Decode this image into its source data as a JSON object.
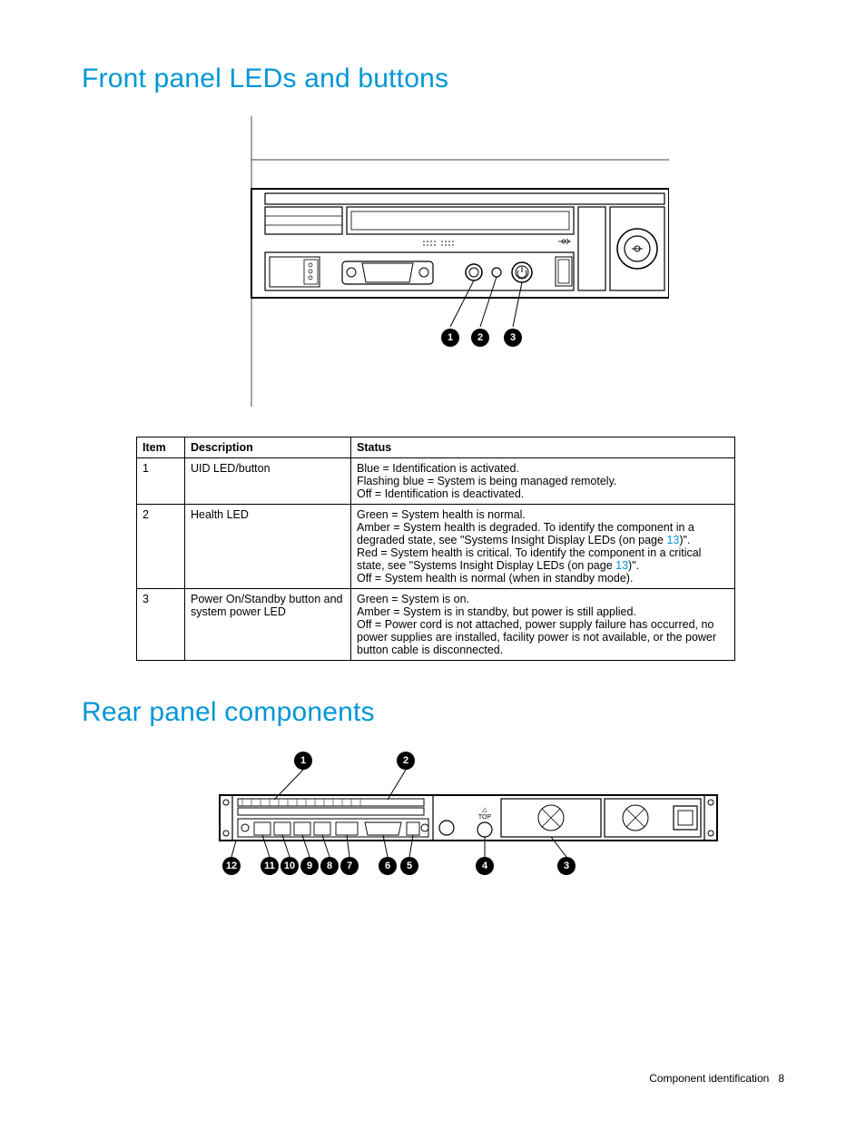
{
  "section1": {
    "heading": "Front panel LEDs and buttons",
    "callouts": [
      "1",
      "2",
      "3"
    ],
    "table": {
      "headers": [
        "Item",
        "Description",
        "Status"
      ],
      "rows": [
        {
          "item": "1",
          "description": "UID LED/button",
          "status_lines": [
            "Blue = Identification is activated.",
            "Flashing blue = System is being managed remotely.",
            "Off = Identification is deactivated."
          ]
        },
        {
          "item": "2",
          "description": "Health LED",
          "status_lines": [
            "Green = System health is normal.",
            {
              "pre": "Amber = System health is degraded. To identify the component in a degraded state, see \"Systems Insight Display LEDs (on page ",
              "link": "13",
              "post": ")\"."
            },
            {
              "pre": "Red = System health is critical. To identify the component in a critical state, see \"Systems Insight Display LEDs (on page ",
              "link": "13",
              "post": ")\"."
            },
            "Off = System health is normal (when in standby mode)."
          ]
        },
        {
          "item": "3",
          "description": "Power On/Standby button and system power LED",
          "status_lines": [
            "Green = System is on.",
            "Amber = System is in standby, but power is still applied.",
            "Off = Power cord is not attached, power supply failure has occurred, no power supplies are installed, facility power is not available, or the power button cable is disconnected."
          ]
        }
      ]
    }
  },
  "section2": {
    "heading": "Rear panel components",
    "callouts_top": [
      "1",
      "2"
    ],
    "callouts_bottom": [
      "12",
      "11",
      "10",
      "9",
      "8",
      "7",
      "6",
      "5",
      "4",
      "3"
    ]
  },
  "footer": {
    "text": "Component identification",
    "page": "8"
  }
}
